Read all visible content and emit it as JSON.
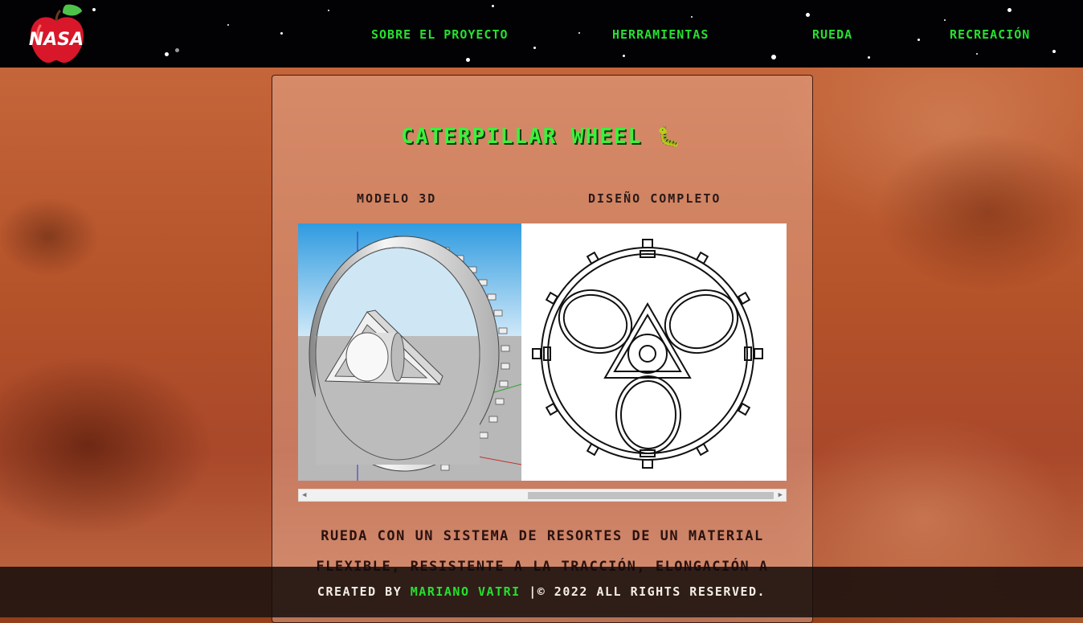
{
  "nav": {
    "items": [
      {
        "label": "Sobre el proyecto"
      },
      {
        "label": "Herramientas"
      },
      {
        "label": "Rueda"
      },
      {
        "label": "Recreación"
      }
    ]
  },
  "logo": {
    "text": "NASA"
  },
  "main": {
    "title": "Caterpillar wheel",
    "title_emoji": "🐛",
    "captions": [
      "Modelo 3D",
      "Diseño completo"
    ],
    "description": "Rueda con un sistema de resortes de un material flexible, resistente a la tracción, elongación a"
  },
  "footer": {
    "prefix": "Created by",
    "author": "Mariano Vatri",
    "suffix": "|© 2022 All rights reserved."
  },
  "colors": {
    "accent_green": "#26e02e",
    "header_bg": "#020205"
  }
}
